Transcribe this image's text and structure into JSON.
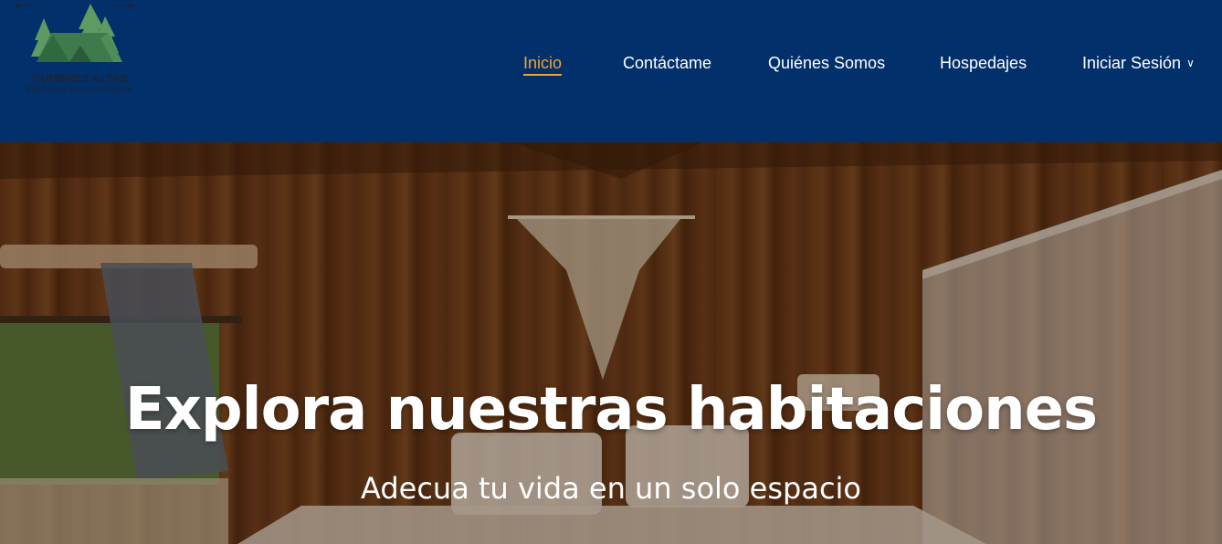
{
  "brand": {
    "name": "CUMBRES ALTAS",
    "tagline": "DESCANSO EN LAS ALTURAS"
  },
  "nav": {
    "items": [
      {
        "label": "Inicio",
        "active": true
      },
      {
        "label": "Contáctame",
        "active": false
      },
      {
        "label": "Quiénes Somos",
        "active": false
      },
      {
        "label": "Hospedajes",
        "active": false
      },
      {
        "label": "Iniciar Sesión",
        "active": false,
        "has_dropdown": true
      }
    ]
  },
  "hero": {
    "title": "Explora nuestras habitaciones",
    "subtitle": "Adecua tu vida en un solo espacio"
  },
  "colors": {
    "header_bg": "#02306a",
    "active_link": "#f0a52f",
    "link": "#ffffff",
    "logo_green": "#4f8a55"
  },
  "icons": {
    "dropdown": "chevron-down-icon",
    "logo": "tent-trees-icon"
  }
}
